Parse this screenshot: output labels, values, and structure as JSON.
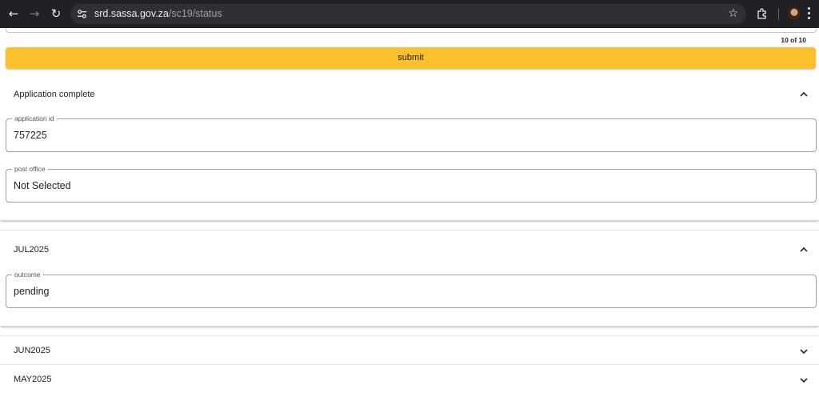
{
  "browser": {
    "nav": {
      "back": "←",
      "forward": "→",
      "reload": "↻"
    },
    "url": {
      "host": "srd.sassa.gov.za",
      "path": "/sc19/status"
    },
    "bookmark_icon": "star-icon"
  },
  "page": {
    "counter": "10 of 10",
    "submit_label": "submit",
    "sections": [
      {
        "title": "Application complete",
        "expanded": true,
        "fields": [
          {
            "label": "application id",
            "value": "757225"
          },
          {
            "label": "post office",
            "value": "Not Selected"
          }
        ]
      },
      {
        "title": "JUL2025",
        "expanded": true,
        "fields": [
          {
            "label": "outcome",
            "value": "pending"
          }
        ]
      },
      {
        "title": "JUN2025",
        "expanded": false
      },
      {
        "title": "MAY2025",
        "expanded": false
      }
    ]
  },
  "colors": {
    "accent": "#fbc02d",
    "chrome": "#202124"
  }
}
